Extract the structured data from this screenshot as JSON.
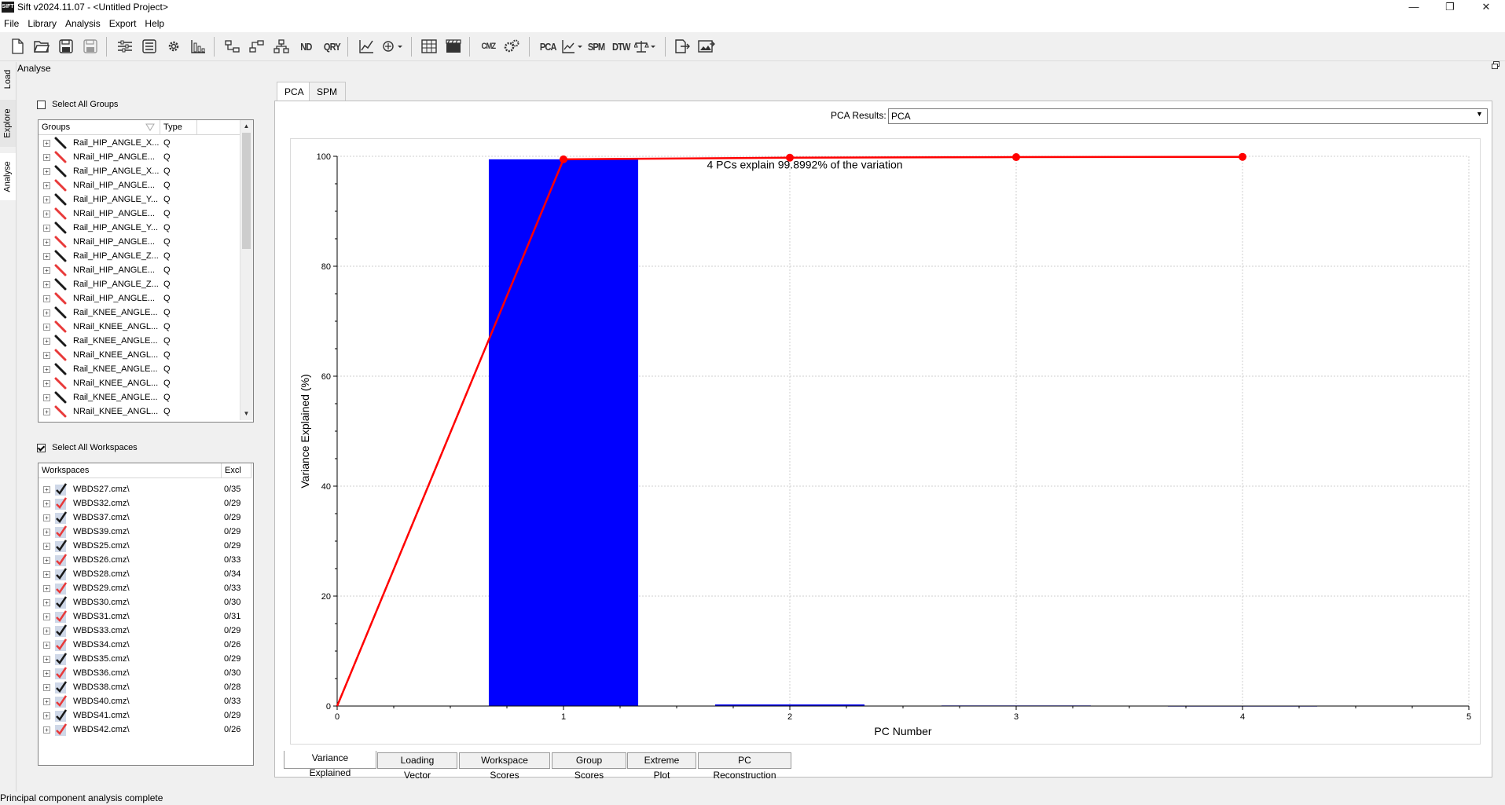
{
  "window": {
    "icon_text": "SIFT",
    "title": "Sift v2024.11.07 - <Untitled Project>",
    "controls": [
      "—",
      "❐",
      "✕"
    ]
  },
  "menu": [
    "File",
    "Library",
    "Analysis",
    "Export",
    "Help"
  ],
  "toolbar": {
    "text_buttons": {
      "nd": "ND",
      "qry": "QRY",
      "cmz": "CMZ",
      "pca": "PCA",
      "spm": "SPM",
      "dtw": "DTW"
    }
  },
  "side_tabs": [
    "Load",
    "Explore",
    "Analyse"
  ],
  "panel_title": "Analyse",
  "groups_panel": {
    "select_all_label": "Select All Groups",
    "select_all_checked": false,
    "columns": [
      "Groups",
      "Type"
    ],
    "rows": [
      {
        "label": "Rail_HIP_ANGLE_X...",
        "type": "Q",
        "color": "#1a1a1a"
      },
      {
        "label": "NRail_HIP_ANGLE...",
        "type": "Q",
        "color": "#e83a3a"
      },
      {
        "label": "Rail_HIP_ANGLE_X...",
        "type": "Q",
        "color": "#1a1a1a"
      },
      {
        "label": "NRail_HIP_ANGLE...",
        "type": "Q",
        "color": "#e83a3a"
      },
      {
        "label": "Rail_HIP_ANGLE_Y...",
        "type": "Q",
        "color": "#1a1a1a"
      },
      {
        "label": "NRail_HIP_ANGLE...",
        "type": "Q",
        "color": "#e83a3a"
      },
      {
        "label": "Rail_HIP_ANGLE_Y...",
        "type": "Q",
        "color": "#1a1a1a"
      },
      {
        "label": "NRail_HIP_ANGLE...",
        "type": "Q",
        "color": "#e83a3a"
      },
      {
        "label": "Rail_HIP_ANGLE_Z...",
        "type": "Q",
        "color": "#1a1a1a"
      },
      {
        "label": "NRail_HIP_ANGLE...",
        "type": "Q",
        "color": "#e83a3a"
      },
      {
        "label": "Rail_HIP_ANGLE_Z...",
        "type": "Q",
        "color": "#1a1a1a"
      },
      {
        "label": "NRail_HIP_ANGLE...",
        "type": "Q",
        "color": "#e83a3a"
      },
      {
        "label": "Rail_KNEE_ANGLE...",
        "type": "Q",
        "color": "#1a1a1a"
      },
      {
        "label": "NRail_KNEE_ANGL...",
        "type": "Q",
        "color": "#e83a3a"
      },
      {
        "label": "Rail_KNEE_ANGLE...",
        "type": "Q",
        "color": "#1a1a1a"
      },
      {
        "label": "NRail_KNEE_ANGL...",
        "type": "Q",
        "color": "#e83a3a"
      },
      {
        "label": "Rail_KNEE_ANGLE...",
        "type": "Q",
        "color": "#1a1a1a"
      },
      {
        "label": "NRail_KNEE_ANGL...",
        "type": "Q",
        "color": "#e83a3a"
      },
      {
        "label": "Rail_KNEE_ANGLE...",
        "type": "Q",
        "color": "#1a1a1a"
      },
      {
        "label": "NRail_KNEE_ANGL...",
        "type": "Q",
        "color": "#e83a3a"
      }
    ]
  },
  "workspaces_panel": {
    "select_all_label": "Select All Workspaces",
    "select_all_checked": true,
    "columns": [
      "Workspaces",
      "Excl"
    ],
    "rows": [
      {
        "label": "WBDS27.cmz\\",
        "excl": "0/35",
        "color": "#1a1a1a"
      },
      {
        "label": "WBDS32.cmz\\",
        "excl": "0/29",
        "color": "#e83a3a"
      },
      {
        "label": "WBDS37.cmz\\",
        "excl": "0/29",
        "color": "#1a1a1a"
      },
      {
        "label": "WBDS39.cmz\\",
        "excl": "0/29",
        "color": "#e83a3a"
      },
      {
        "label": "WBDS25.cmz\\",
        "excl": "0/29",
        "color": "#1a1a1a"
      },
      {
        "label": "WBDS26.cmz\\",
        "excl": "0/33",
        "color": "#e83a3a"
      },
      {
        "label": "WBDS28.cmz\\",
        "excl": "0/34",
        "color": "#1a1a1a"
      },
      {
        "label": "WBDS29.cmz\\",
        "excl": "0/33",
        "color": "#e83a3a"
      },
      {
        "label": "WBDS30.cmz\\",
        "excl": "0/30",
        "color": "#1a1a1a"
      },
      {
        "label": "WBDS31.cmz\\",
        "excl": "0/31",
        "color": "#e83a3a"
      },
      {
        "label": "WBDS33.cmz\\",
        "excl": "0/29",
        "color": "#1a1a1a"
      },
      {
        "label": "WBDS34.cmz\\",
        "excl": "0/26",
        "color": "#e83a3a"
      },
      {
        "label": "WBDS35.cmz\\",
        "excl": "0/29",
        "color": "#1a1a1a"
      },
      {
        "label": "WBDS36.cmz\\",
        "excl": "0/30",
        "color": "#e83a3a"
      },
      {
        "label": "WBDS38.cmz\\",
        "excl": "0/28",
        "color": "#1a1a1a"
      },
      {
        "label": "WBDS40.cmz\\",
        "excl": "0/33",
        "color": "#e83a3a"
      },
      {
        "label": "WBDS41.cmz\\",
        "excl": "0/29",
        "color": "#1a1a1a"
      },
      {
        "label": "WBDS42.cmz\\",
        "excl": "0/26",
        "color": "#e83a3a"
      }
    ]
  },
  "top_tabs": [
    {
      "label": "PCA",
      "active": true
    },
    {
      "label": "SPM",
      "active": false
    }
  ],
  "pca_results": {
    "label": "PCA Results:",
    "value": "PCA"
  },
  "bottom_tabs": [
    {
      "label": "Variance Explained",
      "active": true
    },
    {
      "label": "Loading Vector",
      "active": false
    },
    {
      "label": "Workspace Scores",
      "active": false
    },
    {
      "label": "Group Scores",
      "active": false
    },
    {
      "label": "Extreme Plot",
      "active": false
    },
    {
      "label": "PC Reconstruction",
      "active": false
    }
  ],
  "status": "Principal component analysis complete",
  "chart_data": {
    "type": "bar",
    "title": "",
    "annotation": "4 PCs explain 99.8992% of the variation",
    "xlabel": "PC Number",
    "ylabel": "Variance Explained (%)",
    "xlim": [
      0,
      5
    ],
    "ylim": [
      0,
      100
    ],
    "xticks": [
      0,
      1,
      2,
      3,
      4,
      5
    ],
    "yticks": [
      0,
      20,
      40,
      60,
      80,
      100
    ],
    "grid": true,
    "bars": {
      "x": [
        1,
        2,
        3,
        4
      ],
      "values": [
        99.45,
        0.3,
        0.1,
        0.05
      ],
      "color": "#0000ff"
    },
    "cumulative_line": {
      "x": [
        0,
        1,
        2,
        3,
        4
      ],
      "values": [
        0,
        99.45,
        99.75,
        99.85,
        99.8992
      ],
      "color": "#ff0000"
    }
  }
}
